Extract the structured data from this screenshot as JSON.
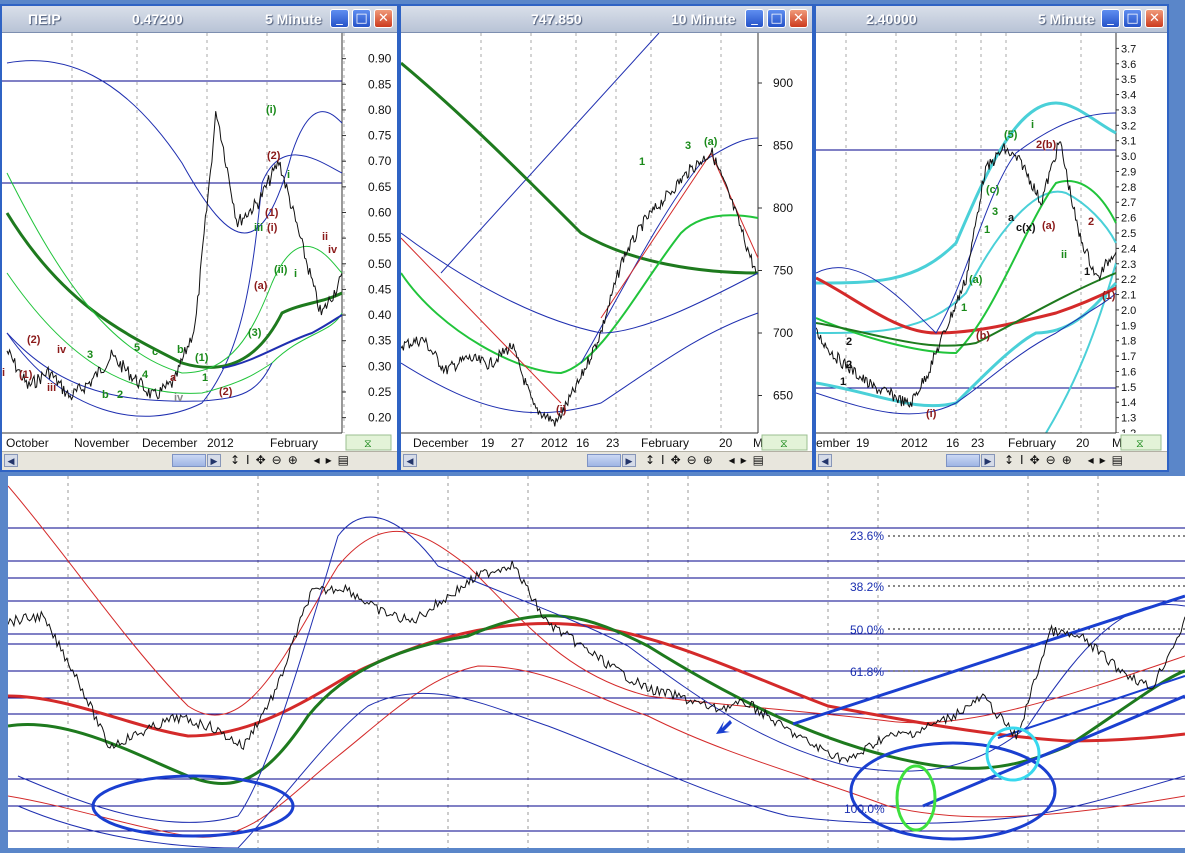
{
  "windows": [
    {
      "symbol": "ΠΕΙΡ",
      "price": "0.47200",
      "interval": "5 Minute",
      "y_ticks": [
        "0.90",
        "0.85",
        "0.80",
        "0.75",
        "0.70",
        "0.65",
        "0.60",
        "0.55",
        "0.50",
        "0.45",
        "0.40",
        "0.35",
        "0.30",
        "0.25",
        "0.20"
      ],
      "x_labels": [
        "October",
        "November",
        "December",
        "2012",
        "February"
      ],
      "wave_labels": [
        "(i)",
        "(2)",
        "(1)",
        "i",
        "(2)",
        "(1)",
        "iii",
        "iv",
        "a",
        "b",
        "c",
        "3",
        "5",
        "4",
        "2",
        "b",
        "iv",
        "1",
        "(1)",
        "(2)",
        "(3)",
        "(a)",
        "(i)",
        "(ii)",
        "iii",
        "i",
        "ii",
        "iv",
        "i"
      ]
    },
    {
      "symbol": "",
      "price": "747.850",
      "interval": "10 Minute",
      "y_ticks": [
        "900",
        "850",
        "800",
        "750",
        "700",
        "650"
      ],
      "x_labels": [
        "December",
        "19",
        "27",
        "2012",
        "16",
        "23",
        "February",
        "20",
        "M"
      ],
      "wave_labels": [
        "(i)",
        "1",
        "3",
        "(a)"
      ]
    },
    {
      "symbol": "",
      "price": "2.40000",
      "interval": "5 Minute",
      "y_ticks": [
        "3.7",
        "3.6",
        "3.5",
        "3.4",
        "3.3",
        "3.2",
        "3.1",
        "3.0",
        "2.9",
        "2.8",
        "2.7",
        "2.6",
        "2.5",
        "2.4",
        "2.3",
        "2.2",
        "2.1",
        "2.0",
        "1.9",
        "1.8",
        "1.7",
        "1.6",
        "1.5",
        "1.4",
        "1.3",
        "1.2"
      ],
      "x_labels": [
        "ember",
        "19",
        "2012",
        "16",
        "23",
        "February",
        "20",
        "M"
      ],
      "wave_labels": [
        "(5)",
        "i",
        "2(b)",
        "(c)",
        "3",
        "1",
        "(a)",
        "(a)",
        "ii",
        "2",
        "1",
        "(1)",
        "1",
        "2",
        "(i)",
        "(b)",
        "1",
        "2",
        "a",
        "c(x)"
      ]
    }
  ],
  "bottom_chart": {
    "fib_labels": [
      "23.6%",
      "38.2%",
      "50.0%",
      "61.8%",
      "100.0%"
    ]
  },
  "chart_data": [
    {
      "type": "line",
      "title": "ΠΕΙΡ 5 Minute",
      "x": [
        "October",
        "November",
        "December",
        "2012",
        "February"
      ],
      "ylim": [
        0.17,
        0.95
      ],
      "series": [
        {
          "values": [
            0.33,
            0.26,
            0.29,
            0.24,
            0.27,
            0.32,
            0.28,
            0.24,
            0.27,
            0.38,
            0.8,
            0.58,
            0.62,
            0.7,
            0.55,
            0.4,
            0.472
          ]
        }
      ]
    },
    {
      "type": "line",
      "title": "747.850 10 Minute",
      "x": [
        "December",
        "19",
        "27",
        "2012",
        "16",
        "23",
        "February",
        "20",
        "M"
      ],
      "ylim": [
        620,
        940
      ],
      "series": [
        {
          "values": [
            690,
            695,
            670,
            680,
            675,
            690,
            640,
            628,
            660,
            700,
            760,
            790,
            810,
            830,
            845,
            800,
            748
          ]
        }
      ]
    },
    {
      "type": "line",
      "title": "2.40000 5 Minute",
      "x": [
        "ember",
        "19",
        "2012",
        "16",
        "23",
        "February",
        "20",
        "M"
      ],
      "ylim": [
        1.2,
        3.8
      ],
      "series": [
        {
          "values": [
            1.85,
            1.7,
            1.6,
            1.5,
            1.45,
            1.38,
            1.6,
            1.9,
            2.2,
            2.9,
            3.05,
            2.95,
            2.7,
            3.1,
            2.5,
            2.2,
            2.4
          ]
        }
      ]
    }
  ]
}
